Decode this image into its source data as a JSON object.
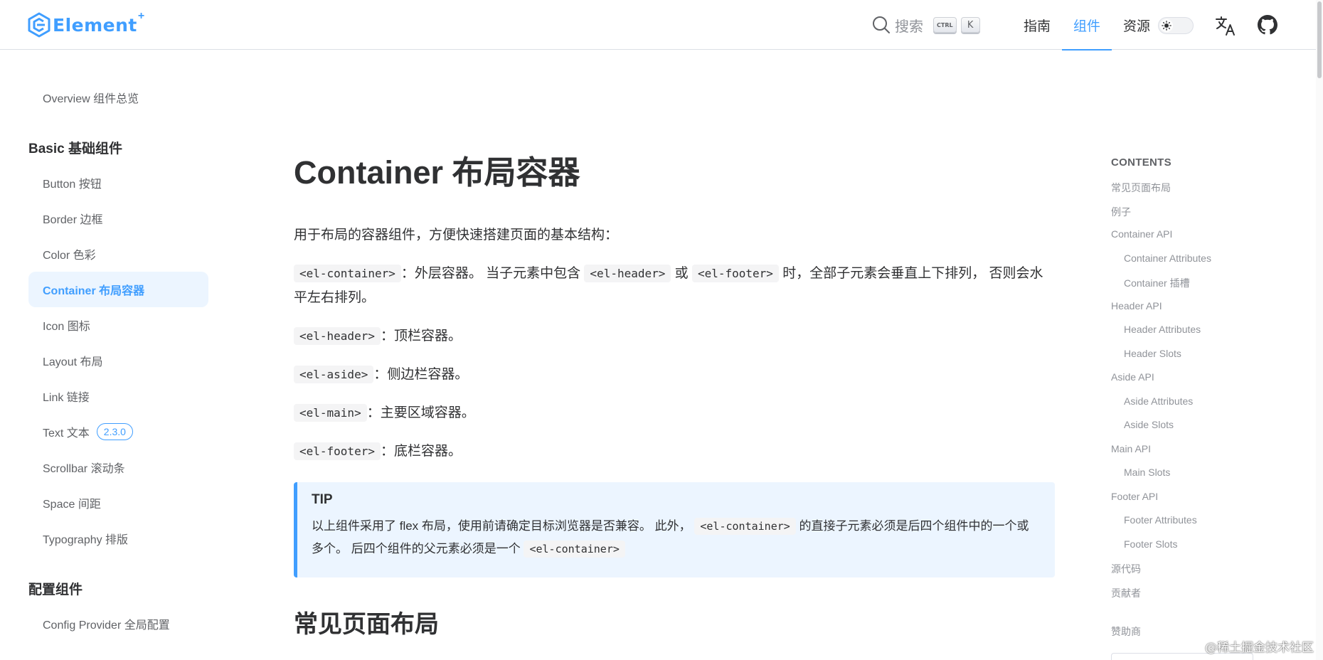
{
  "header": {
    "logo_text": "Element",
    "logo_sup": "+",
    "search_placeholder": "搜索",
    "kbd_ctrl": "CTRL",
    "kbd_k": "K",
    "nav": [
      {
        "label": "指南",
        "active": false
      },
      {
        "label": "组件",
        "active": true
      },
      {
        "label": "资源",
        "active": false
      }
    ]
  },
  "sidebar": {
    "overview": "Overview 组件总览",
    "group_basic": "Basic 基础组件",
    "items": [
      "Button 按钮",
      "Border 边框",
      "Color 色彩",
      "Container 布局容器",
      "Icon 图标",
      "Layout 布局",
      "Link 链接",
      "Text 文本",
      "Scrollbar 滚动条",
      "Space 间距",
      "Typography 排版"
    ],
    "active_item": "Container 布局容器",
    "text_badge": "2.3.0",
    "group_config": "配置组件",
    "config_items": [
      "Config Provider 全局配置"
    ]
  },
  "main": {
    "title": "Container 布局容器",
    "intro": "用于布局的容器组件，方便快速搭建页面的基本结构：",
    "container_code": "<el-container>",
    "container_desc_1": "：外层容器。 当子元素中包含",
    "header_code": "<el-header>",
    "or": "或",
    "footer_code": "<el-footer>",
    "container_desc_2": "时，全部子元素会垂直上下排列， 否则会水平左右排列。",
    "header_desc": "：顶栏容器。",
    "aside_code": "<el-aside>",
    "aside_desc": "：侧边栏容器。",
    "main_code": "<el-main>",
    "main_desc": "：主要区域容器。",
    "footer_desc": "：底栏容器。",
    "tip_title": "TIP",
    "tip_text_1": "以上组件采用了 flex 布局，使用前请确定目标浏览器是否兼容。 此外，",
    "tip_code_1": "<el-container>",
    "tip_text_2": "的直接子元素必须是后四个组件中的一个或多个。 后四个组件的父元素必须是一个",
    "tip_code_2": "<el-container>",
    "section_title": "常见页面布局"
  },
  "toc": {
    "heading": "CONTENTS",
    "items": [
      {
        "label": "常见页面布局",
        "sub": false
      },
      {
        "label": "例子",
        "sub": false
      },
      {
        "label": "Container API",
        "sub": false
      },
      {
        "label": "Container Attributes",
        "sub": true
      },
      {
        "label": "Container 插槽",
        "sub": true
      },
      {
        "label": "Header API",
        "sub": false
      },
      {
        "label": "Header Attributes",
        "sub": true
      },
      {
        "label": "Header Slots",
        "sub": true
      },
      {
        "label": "Aside API",
        "sub": false
      },
      {
        "label": "Aside Attributes",
        "sub": true
      },
      {
        "label": "Aside Slots",
        "sub": true
      },
      {
        "label": "Main API",
        "sub": false
      },
      {
        "label": "Main Slots",
        "sub": true
      },
      {
        "label": "Footer API",
        "sub": false
      },
      {
        "label": "Footer Attributes",
        "sub": true
      },
      {
        "label": "Footer Slots",
        "sub": true
      },
      {
        "label": "源代码",
        "sub": false
      },
      {
        "label": "贡献者",
        "sub": false
      }
    ],
    "sponsor": "赞助商"
  },
  "watermark": "@稀土掘金技术社区",
  "colors": {
    "accent": "#409eff",
    "accent_bg": "#ecf5ff",
    "text": "#303133",
    "muted": "#909399"
  }
}
